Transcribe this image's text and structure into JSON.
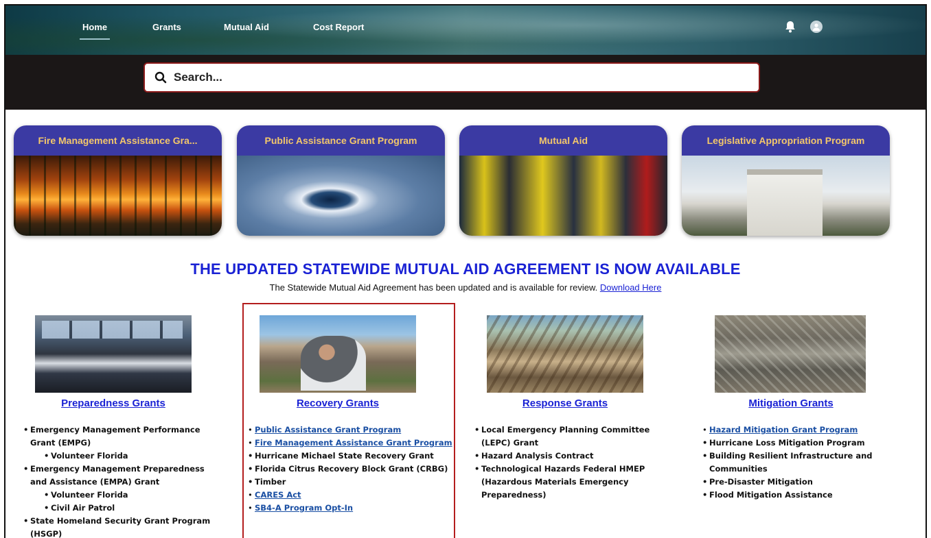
{
  "nav": {
    "items": [
      {
        "label": "Home",
        "active": true
      },
      {
        "label": "Grants",
        "active": false
      },
      {
        "label": "Mutual Aid",
        "active": false
      },
      {
        "label": "Cost Report",
        "active": false
      }
    ],
    "icons": [
      "bell-icon",
      "avatar-icon"
    ]
  },
  "search": {
    "placeholder": "Search..."
  },
  "tiles": [
    {
      "label": "Fire Management Assistance Gra...",
      "image": "wildfire"
    },
    {
      "label": "Public Assistance Grant Program",
      "image": "hurricane-satellite"
    },
    {
      "label": "Mutual Aid",
      "image": "rescue-workers"
    },
    {
      "label": "Legislative Appropriation Program",
      "image": "capitol-building"
    }
  ],
  "announcement": {
    "title": "THE UPDATED STATEWIDE MUTUAL AID AGREEMENT IS NOW AVAILABLE",
    "text": "The Statewide Mutual Aid Agreement has been updated and is available for review. ",
    "link": "Download Here"
  },
  "grants": {
    "preparedness": {
      "title": "Preparedness Grants",
      "items": [
        {
          "text": "Emergency Management Performance Grant (EMPG)"
        },
        {
          "text": "Volunteer Florida",
          "sub": true
        },
        {
          "text": "Emergency Management Preparedness and Assistance (EMPA) Grant"
        },
        {
          "text": "Volunteer Florida",
          "sub": true
        },
        {
          "text": "Civil Air Patrol",
          "sub": true
        },
        {
          "text": "State Homeland Security Grant Program (HSGP)"
        }
      ]
    },
    "recovery": {
      "title": "Recovery Grants",
      "items": [
        {
          "text": "Public Assistance Grant Program",
          "link": true
        },
        {
          "text": "Fire Management Assistance Grant Program",
          "link": true
        },
        {
          "text": "Hurricane Michael State Recovery Grant"
        },
        {
          "text": "Florida Citrus Recovery Block Grant (CRBG)"
        },
        {
          "text": "Timber"
        },
        {
          "text": "CARES Act",
          "link": true
        },
        {
          "text": "SB4-A Program Opt-In",
          "link": true
        }
      ]
    },
    "response": {
      "title": "Response Grants",
      "items": [
        {
          "text": "Local Emergency Planning Committee (LEPC) Grant"
        },
        {
          "text": "Hazard Analysis Contract"
        },
        {
          "text": "Technological Hazards Federal HMEP (Hazardous Materials Emergency Preparedness)"
        }
      ]
    },
    "mitigation": {
      "title": "Mitigation Grants",
      "items": [
        {
          "text": "Hazard Mitigation Grant Program",
          "link": true
        },
        {
          "text": "Hurricane Loss Mitigation Program"
        },
        {
          "text": "Building Resilient Infrastructure and Communities"
        },
        {
          "text": "Pre-Disaster Mitigation"
        },
        {
          "text": "Flood Mitigation Assistance"
        }
      ]
    }
  }
}
